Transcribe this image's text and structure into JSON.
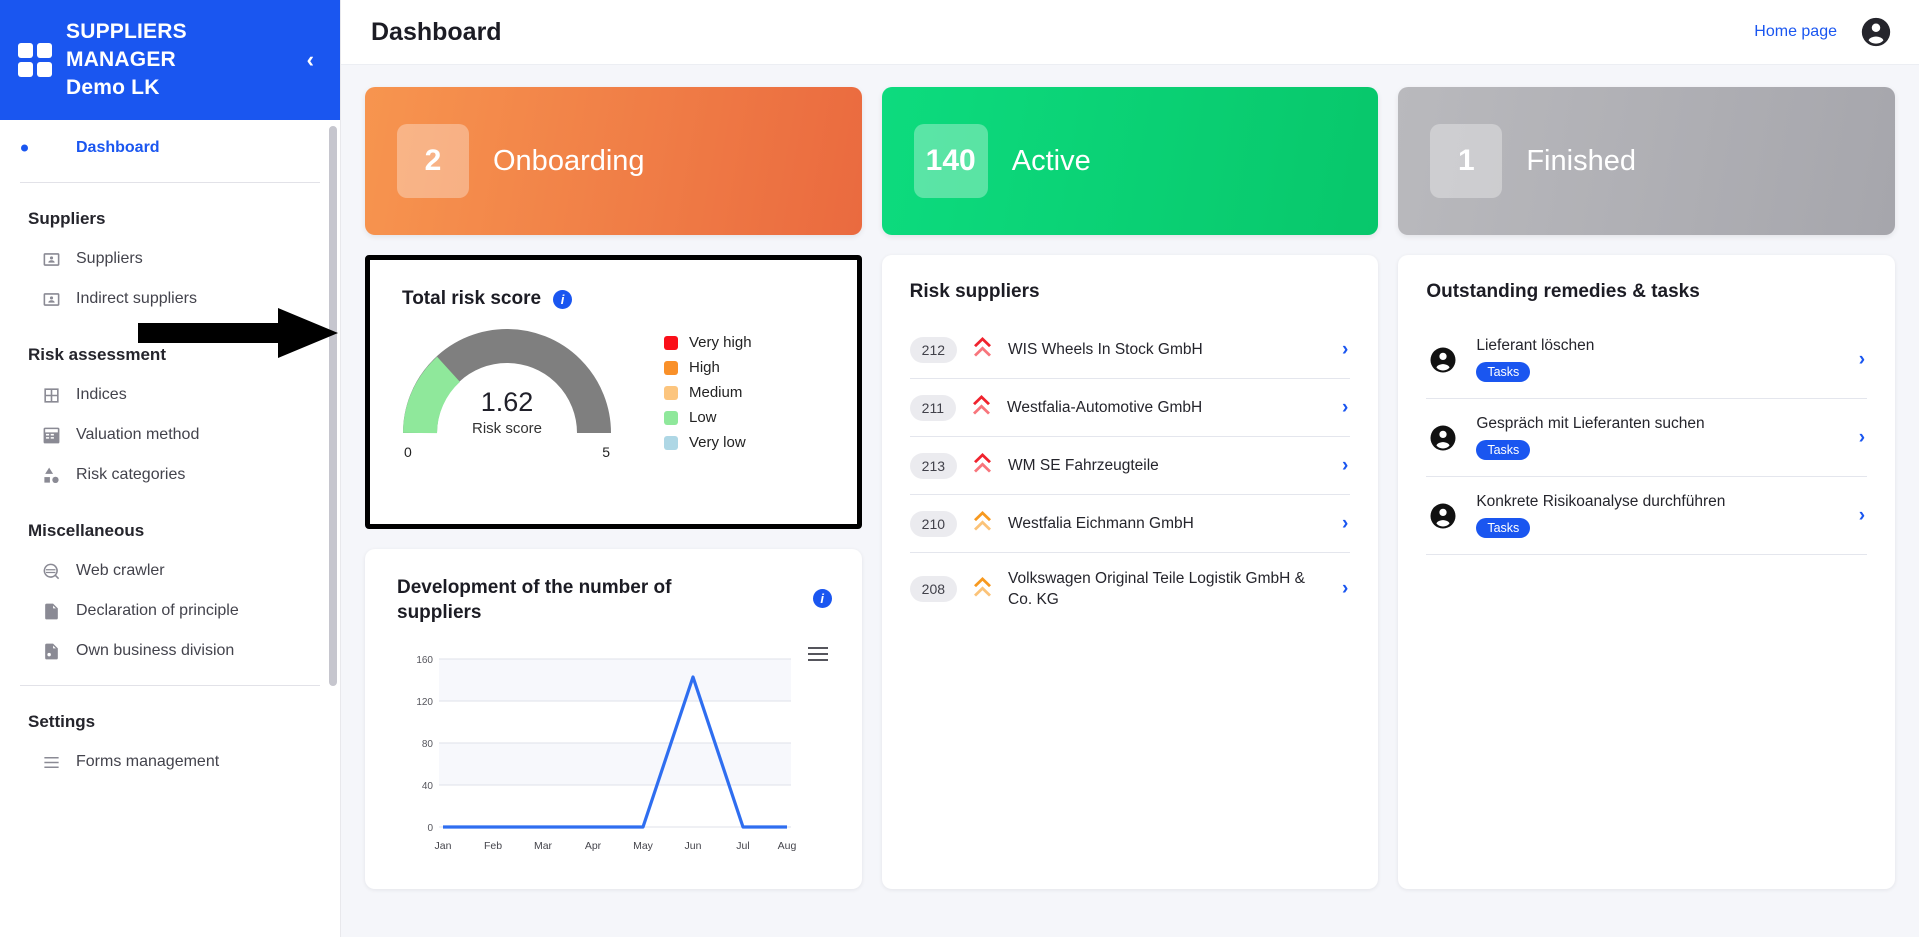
{
  "brand": {
    "line1": "SUPPLIERS",
    "line2": "MANAGER",
    "line3": "Demo LK",
    "collapse_icon": "chevron-left-icon"
  },
  "sidebar": {
    "active_item": "Dashboard",
    "sections": [
      {
        "heading": null,
        "items": [
          {
            "label": "Dashboard",
            "icon": "dashboard-icon",
            "active": true
          }
        ]
      },
      {
        "heading": "Suppliers",
        "items": [
          {
            "label": "Suppliers",
            "icon": "id-card-icon"
          },
          {
            "label": "Indirect suppliers",
            "icon": "id-card-icon"
          }
        ]
      },
      {
        "heading": "Risk assessment",
        "items": [
          {
            "label": "Indices",
            "icon": "grid-icon"
          },
          {
            "label": "Valuation method",
            "icon": "calculator-icon"
          },
          {
            "label": "Risk categories",
            "icon": "shapes-icon"
          }
        ]
      },
      {
        "heading": "Miscellaneous",
        "items": [
          {
            "label": "Web crawler",
            "icon": "web-search-icon"
          },
          {
            "label": "Declaration of principle",
            "icon": "document-icon"
          },
          {
            "label": "Own business division",
            "icon": "document-gear-icon"
          }
        ]
      },
      {
        "heading": "Settings",
        "items": [
          {
            "label": "Forms management",
            "icon": "list-icon"
          }
        ]
      }
    ]
  },
  "header": {
    "title": "Dashboard",
    "home_link": "Home page",
    "avatar_icon": "account-circle-icon"
  },
  "stats": [
    {
      "count": "2",
      "label": "Onboarding",
      "color": "#ef7b46"
    },
    {
      "count": "140",
      "label": "Active",
      "color": "#0ace74"
    },
    {
      "count": "1",
      "label": "Finished",
      "color": "#b0b0b5"
    }
  ],
  "risk_score": {
    "title": "Total risk score",
    "info_icon": "info-icon",
    "value": "1.62",
    "value_caption": "Risk score",
    "scale_min": "0",
    "scale_max": "5",
    "legend": [
      {
        "label": "Very high",
        "color": "#fa0f19"
      },
      {
        "label": "High",
        "color": "#f99029"
      },
      {
        "label": "Medium",
        "color": "#fcc57e"
      },
      {
        "label": "Low",
        "color": "#8fe89b"
      },
      {
        "label": "Very low",
        "color": "#aed7e5"
      }
    ]
  },
  "chart_data": {
    "type": "line",
    "title": "Development of the number of suppliers",
    "info_icon": "info-icon",
    "menu_icon": "hamburger-menu-icon",
    "categories": [
      "Jan",
      "Feb",
      "Mar",
      "Apr",
      "May",
      "Jun",
      "Jul",
      "Aug"
    ],
    "values": [
      0,
      0,
      0,
      0,
      0,
      143,
      0,
      0
    ],
    "series": [
      {
        "name": "Suppliers",
        "values": [
          0,
          0,
          0,
          0,
          0,
          143,
          0,
          0
        ],
        "color": "#2f6ef0"
      }
    ],
    "yticks": [
      0,
      40,
      80,
      120,
      160
    ],
    "ylim": [
      0,
      160
    ],
    "xlabel": "",
    "ylabel": "",
    "grid": true,
    "legend_position": "none"
  },
  "risk_suppliers": {
    "title": "Risk suppliers",
    "rows": [
      {
        "id": "212",
        "name": "WIS Wheels In Stock GmbH",
        "severity": "very-high",
        "severity_color": "#f0232e",
        "chevron": "chevron-right-icon"
      },
      {
        "id": "211",
        "name": "Westfalia-Automotive GmbH",
        "severity": "very-high",
        "severity_color": "#f0232e",
        "chevron": "chevron-right-icon"
      },
      {
        "id": "213",
        "name": "WM SE Fahrzeugteile",
        "severity": "very-high",
        "severity_color": "#f0232e",
        "chevron": "chevron-right-icon"
      },
      {
        "id": "210",
        "name": "Westfalia Eichmann GmbH",
        "severity": "high",
        "severity_color": "#f7991f",
        "chevron": "chevron-right-icon"
      },
      {
        "id": "208",
        "name": "Volkswagen Original Teile Logistik GmbH & Co. KG",
        "severity": "high",
        "severity_color": "#f7991f",
        "chevron": "chevron-right-icon"
      }
    ]
  },
  "tasks": {
    "title": "Outstanding remedies & tasks",
    "rows": [
      {
        "name": "Lieferant löschen",
        "tag": "Tasks",
        "avatar": "account-circle-icon",
        "chevron": "chevron-right-icon"
      },
      {
        "name": "Gespräch mit Lieferanten suchen",
        "tag": "Tasks",
        "avatar": "account-circle-icon",
        "chevron": "chevron-right-icon"
      },
      {
        "name": "Konkrete Risikoanalyse durchführen",
        "tag": "Tasks",
        "avatar": "account-circle-icon",
        "chevron": "chevron-right-icon"
      }
    ]
  },
  "annotation": {
    "arrow": "black-right-arrow-pointer"
  }
}
